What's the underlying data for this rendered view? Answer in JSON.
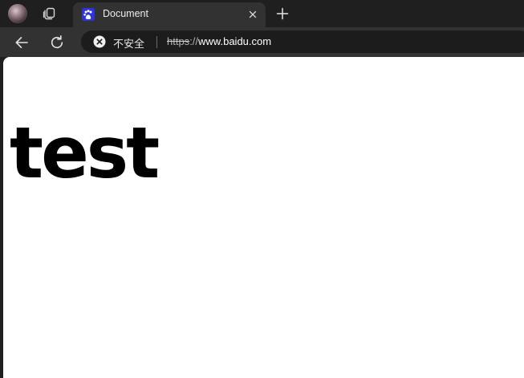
{
  "tab": {
    "title": "Document",
    "favicon": "baidu-paw-icon",
    "favicon_color": "#2f34d9"
  },
  "toolbar": {
    "security_text": "不安全",
    "url_scheme": "https",
    "url_separator": "://",
    "url_host": "www.baidu.com"
  },
  "page": {
    "heading": "test"
  },
  "colors": {
    "chrome_dark": "#1f1f1f",
    "active_tab": "#323232",
    "omnibox": "#1c1c1c",
    "page_background": "#ffffff"
  }
}
